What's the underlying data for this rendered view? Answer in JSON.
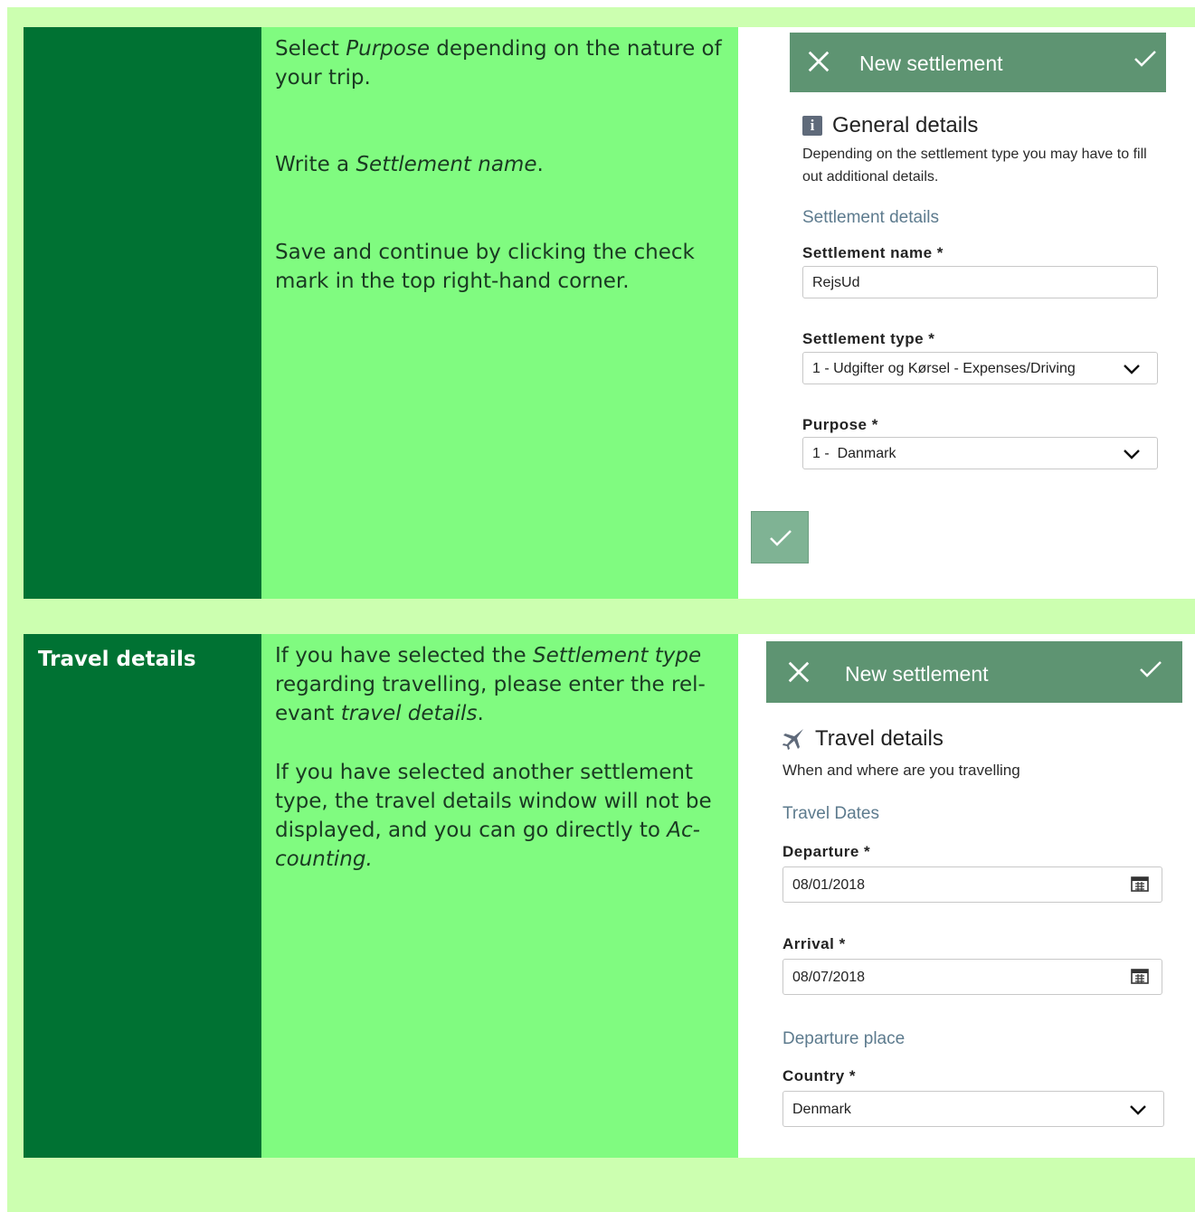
{
  "rows": [
    {
      "label": "",
      "instructions": {
        "p1_a": "Select ",
        "p1_b": "Purpose",
        "p1_c": " depending on the nature of your trip.",
        "p2_a": "Write a ",
        "p2_b": "Settlement name",
        "p2_c": ".",
        "p3": "Save and continue by clicking the check mark in the top right-hand corner."
      },
      "screenshot": {
        "header_title": "New settlement",
        "section_title": "General details",
        "section_desc": "Depending on the settlement type you may have to fill out additional details.",
        "sub_heading": "Settlement details",
        "fields": [
          {
            "label": "Settlement name *",
            "value": "RejsUd",
            "kind": "text"
          },
          {
            "label": "Settlement type *",
            "value": "1 - Udgifter og Kørsel - Expenses/Driving",
            "kind": "select"
          },
          {
            "label": "Purpose *",
            "value": "1 -  Danmark",
            "kind": "select"
          }
        ]
      }
    },
    {
      "label": "Travel details",
      "instructions": {
        "p1_a": "If you have selected the ",
        "p1_b": "Settlement type",
        "p1_c": " regarding travelling, please enter the rel-evant ",
        "p1_d": "travel details",
        "p1_e": ".",
        "p2_a": "If you have selected another settlement type, the travel details window will not be displayed, and you can go directly to ",
        "p2_b": "Ac-counting."
      },
      "screenshot": {
        "header_title": "New settlement",
        "section_title": "Travel details",
        "section_desc": "When and where are you travelling",
        "sub_heading_1": "Travel Dates",
        "departure_label": "Departure *",
        "departure_value": "08/01/2018",
        "arrival_label": "Arrival *",
        "arrival_value": "08/07/2018",
        "sub_heading_2": "Departure place",
        "country_label": "Country *",
        "country_value": "Denmark"
      }
    }
  ],
  "icons": {
    "close": "close-icon",
    "check": "check-icon",
    "info": "info-icon",
    "plane": "plane-icon",
    "chevron": "chevron-down-icon",
    "calendar": "calendar-icon"
  },
  "colors": {
    "page_bg": "#ccffb0",
    "label_col": "#007233",
    "text_col": "#80fb80",
    "app_header": "#5e9472"
  }
}
